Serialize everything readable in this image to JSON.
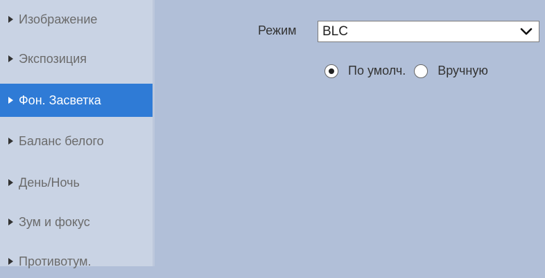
{
  "sidebar": {
    "items": [
      {
        "label": "Изображение"
      },
      {
        "label": "Экспозиция"
      },
      {
        "label": "Фон. Засветка"
      },
      {
        "label": "Баланс белого"
      },
      {
        "label": "День/Ночь"
      },
      {
        "label": "Зум и фокус"
      },
      {
        "label": "Противотум."
      }
    ],
    "active_index": 2,
    "active_color": "#2f7bd6"
  },
  "settings": {
    "mode_label": "Режим",
    "mode_value": "BLC",
    "radio_default_label": "По умолч.",
    "radio_manual_label": "Вручную",
    "radio_selected": "default"
  },
  "icons": {
    "menu_arrow": "triangle-right-icon",
    "select_arrow": "chevron-down-icon"
  }
}
